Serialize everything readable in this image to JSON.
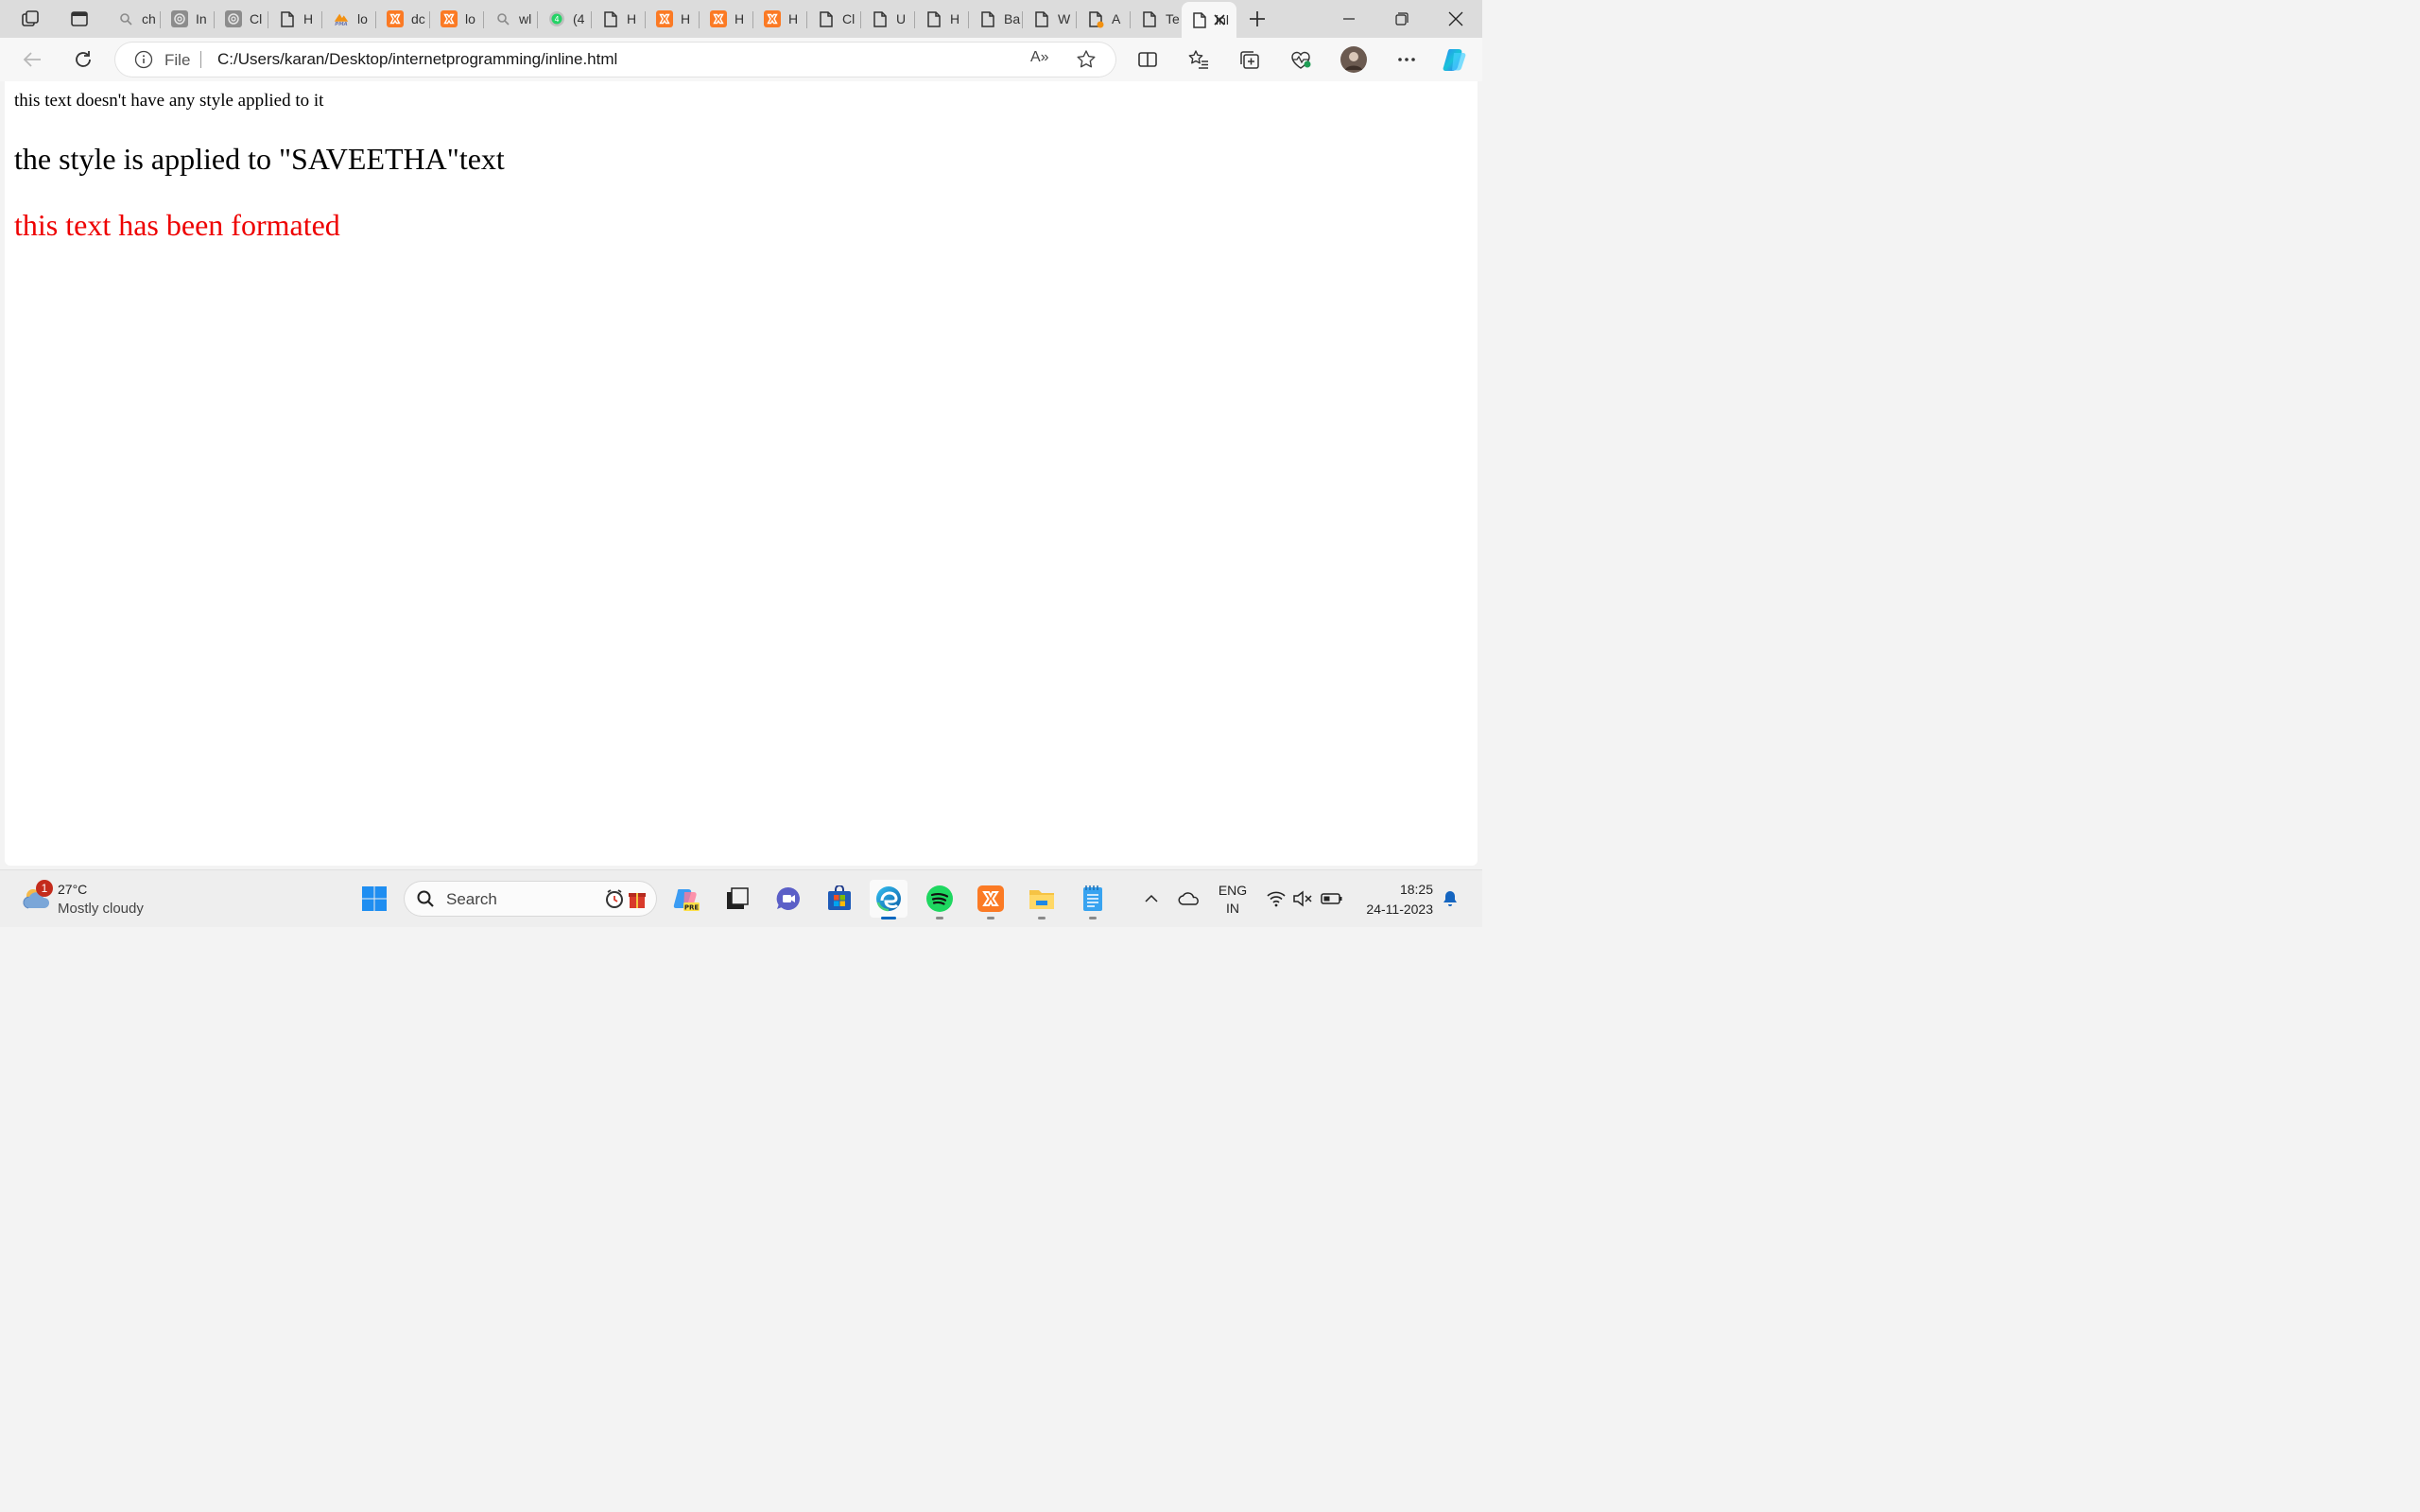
{
  "browser": {
    "tabs": [
      {
        "label": "ch",
        "icon": "search-icon"
      },
      {
        "label": "In",
        "icon": "openai-icon"
      },
      {
        "label": "Cl",
        "icon": "openai-icon"
      },
      {
        "label": "H",
        "icon": "document-icon"
      },
      {
        "label": "lo",
        "icon": "phpmyadmin-icon"
      },
      {
        "label": "dc",
        "icon": "xampp-icon"
      },
      {
        "label": "lo",
        "icon": "xampp-icon"
      },
      {
        "label": "wl",
        "icon": "search-icon"
      },
      {
        "label": "(4",
        "icon": "whatsapp-icon"
      },
      {
        "label": "H",
        "icon": "document-icon"
      },
      {
        "label": "H",
        "icon": "xampp-icon"
      },
      {
        "label": "H",
        "icon": "xampp-icon"
      },
      {
        "label": "H",
        "icon": "xampp-icon"
      },
      {
        "label": "Cl",
        "icon": "document-icon"
      },
      {
        "label": "U",
        "icon": "document-icon"
      },
      {
        "label": "H",
        "icon": "document-icon"
      },
      {
        "label": "Ba",
        "icon": "document-icon"
      },
      {
        "label": "W",
        "icon": "document-icon"
      },
      {
        "label": "A",
        "icon": "document-icon"
      },
      {
        "label": "Te",
        "icon": "document-icon"
      }
    ],
    "active_tab": {
      "label": "inl",
      "icon": "document-icon"
    },
    "address": {
      "scheme_label": "File",
      "url": "C:/Users/karan/Desktop/internetprogramming/inline.html"
    },
    "readaloud_label": "A»"
  },
  "page": {
    "line1": "this text doesn't have any style applied to it",
    "line2": "the style is applied to \"SAVEETHA\"text",
    "line3": "this text has been formated",
    "line3_color": "#ee0000"
  },
  "taskbar": {
    "weather": {
      "temperature": "27°C",
      "condition": "Mostly cloudy",
      "badge": "1"
    },
    "search_label": "Search",
    "language": {
      "line1": "ENG",
      "line2": "IN"
    },
    "clock": {
      "time": "18:25",
      "date": "24-11-2023"
    }
  },
  "colors": {
    "accent": "#0067c0",
    "xampp": "#fb7a24",
    "spotify": "#1ed760"
  }
}
